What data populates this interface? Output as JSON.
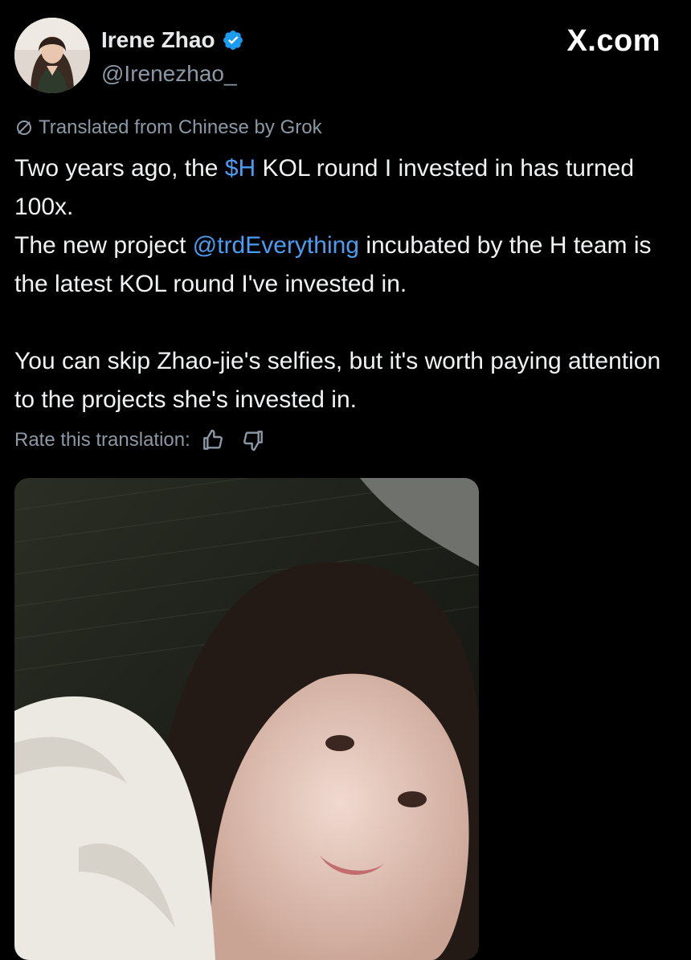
{
  "brand": "X.com",
  "author": {
    "display_name": "Irene Zhao",
    "handle": "@Irenezhao_",
    "verified": true,
    "verified_color": "#1d9bf0"
  },
  "translation": {
    "notice": "Translated from Chinese by Grok",
    "rate_label": "Rate this translation:"
  },
  "tweet": {
    "line1_pre": "Two years ago, the ",
    "line1_cashtag": "$H",
    "line1_post": " KOL round I invested in has turned 100x.",
    "line2_pre": "The new project ",
    "line2_mention": "@trdEverything",
    "line2_post": " incubated by the H team is the latest KOL round I've invested in.",
    "para2": "You can skip Zhao-jie's selfies, but it's worth paying attention to the projects she's invested in.",
    "link_color": "#4a9df0"
  },
  "icons": {
    "verified": "verified-badge-icon",
    "translated": "no-entry-icon",
    "thumbs_up": "thumbs-up-icon",
    "thumbs_down": "thumbs-down-icon"
  }
}
